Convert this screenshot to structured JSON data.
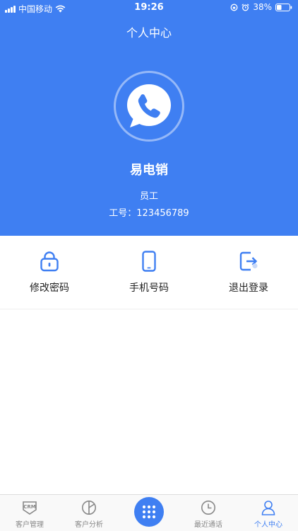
{
  "status_bar": {
    "carrier": "中国移动",
    "time": "19:26",
    "battery": "38%",
    "battery_level": 0.38
  },
  "header": {
    "title": "个人中心",
    "avatar_icon": "phone-chat-bubble-icon",
    "user_name": "易电销",
    "role": "员工",
    "employee_id": "工号：123456789"
  },
  "actions": [
    {
      "label": "修改密码",
      "icon": "lock-icon"
    },
    {
      "label": "手机号码",
      "icon": "mobile-phone-icon"
    },
    {
      "label": "退出登录",
      "icon": "logout-icon"
    }
  ],
  "tab_bar": {
    "tabs": [
      {
        "label": "客户管理",
        "icon": "crm-icon",
        "active": false
      },
      {
        "label": "客户分析",
        "icon": "pie-chart-icon",
        "active": false
      },
      {
        "label": "最近通话",
        "icon": "clock-icon",
        "active": false
      },
      {
        "label": "个人中心",
        "icon": "user-icon",
        "active": true
      }
    ],
    "center_button_icon": "dialpad-icon"
  },
  "colors": {
    "primary": "#3f7ff2",
    "tab_inactive": "#888888",
    "text": "#222222"
  }
}
